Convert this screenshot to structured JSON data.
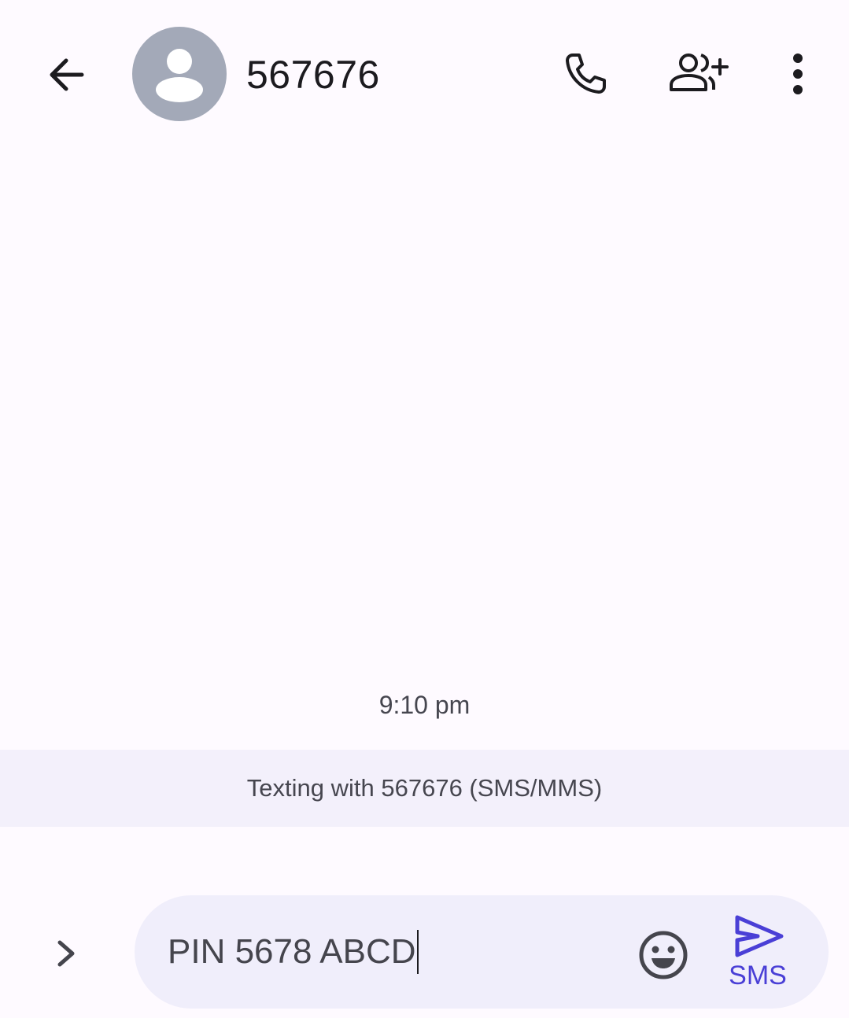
{
  "header": {
    "contact_name": "567676",
    "icons": {
      "back": "arrow-back-icon",
      "avatar": "person-avatar-icon",
      "call": "phone-icon",
      "add_contact": "add-person-icon",
      "more": "more-vert-icon"
    }
  },
  "conversation": {
    "timestamp": "9:10 pm",
    "banner": "Texting with 567676 (SMS/MMS)"
  },
  "compose": {
    "text": "PIN 5678 ABCD",
    "send_label": "SMS",
    "icons": {
      "expand": "chevron-right-icon",
      "emoji": "emoji-icon",
      "send": "send-icon"
    }
  },
  "colors": {
    "background": "#fefaff",
    "banner": "#f3f0fb",
    "compose_pill": "#f0eefb",
    "avatar": "#a3a9b8",
    "accent": "#4a3fd6",
    "text_primary": "#1c1b1f",
    "text_secondary": "#46464f"
  }
}
